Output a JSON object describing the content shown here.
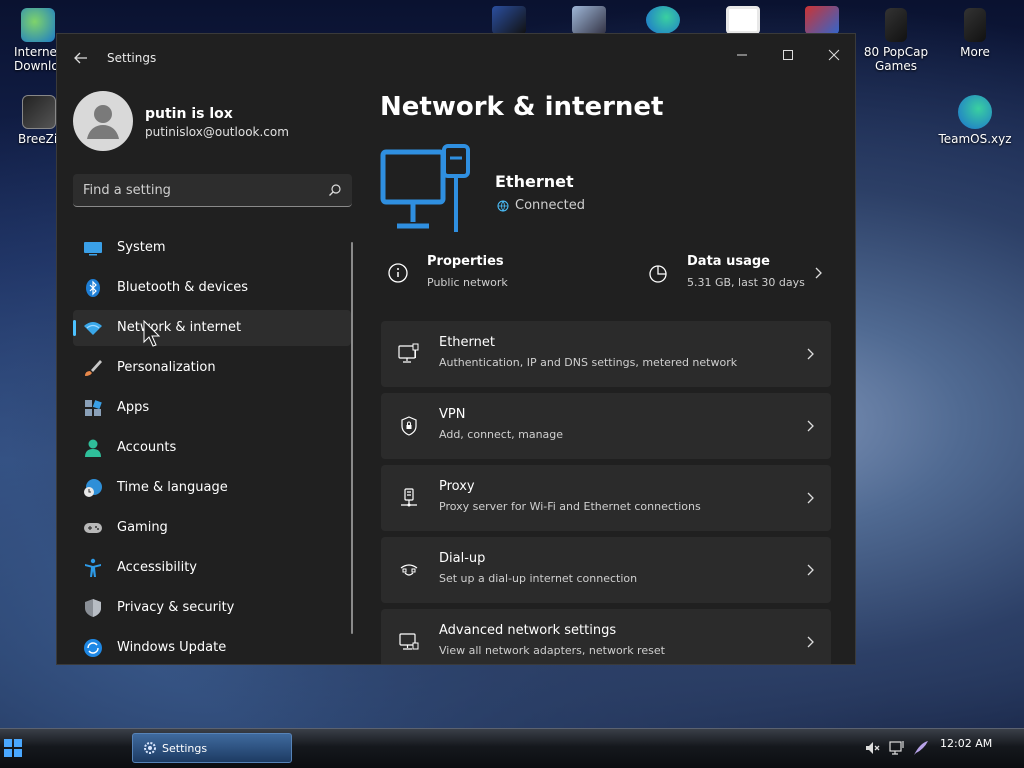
{
  "desktop": {
    "icons": [
      {
        "label": "Interne\nDownlo"
      },
      {
        "label": "BreeZip"
      },
      {
        "label": "80 PopCap Games"
      },
      {
        "label": "More"
      },
      {
        "label": "TeamOS.xyz"
      }
    ]
  },
  "window": {
    "title": "Settings"
  },
  "profile": {
    "name": "putin is lox",
    "email": "putinislox@outlook.com"
  },
  "search": {
    "placeholder": "Find a setting"
  },
  "sidebar": {
    "items": [
      {
        "label": "System",
        "icon": "monitor-icon",
        "active": false
      },
      {
        "label": "Bluetooth & devices",
        "icon": "bluetooth-icon",
        "active": false
      },
      {
        "label": "Network & internet",
        "icon": "wifi-icon",
        "active": true
      },
      {
        "label": "Personalization",
        "icon": "brush-icon",
        "active": false
      },
      {
        "label": "Apps",
        "icon": "apps-icon",
        "active": false
      },
      {
        "label": "Accounts",
        "icon": "person-icon",
        "active": false
      },
      {
        "label": "Time & language",
        "icon": "globe-clock-icon",
        "active": false
      },
      {
        "label": "Gaming",
        "icon": "gamepad-icon",
        "active": false
      },
      {
        "label": "Accessibility",
        "icon": "accessibility-icon",
        "active": false
      },
      {
        "label": "Privacy & security",
        "icon": "shield-icon",
        "active": false
      },
      {
        "label": "Windows Update",
        "icon": "update-icon",
        "active": false
      }
    ]
  },
  "main": {
    "title": "Network & internet",
    "connection": {
      "name": "Ethernet",
      "status": "Connected"
    },
    "properties": {
      "title": "Properties",
      "subtitle": "Public network"
    },
    "data_usage": {
      "title": "Data usage",
      "subtitle": "5.31 GB, last 30 days"
    },
    "rows": [
      {
        "title": "Ethernet",
        "subtitle": "Authentication, IP and DNS settings, metered network",
        "icon": "ethernet-icon"
      },
      {
        "title": "VPN",
        "subtitle": "Add, connect, manage",
        "icon": "vpn-shield-icon"
      },
      {
        "title": "Proxy",
        "subtitle": "Proxy server for Wi-Fi and Ethernet connections",
        "icon": "proxy-icon"
      },
      {
        "title": "Dial-up",
        "subtitle": "Set up a dial-up internet connection",
        "icon": "dialup-icon"
      },
      {
        "title": "Advanced network settings",
        "subtitle": "View all network adapters, network reset",
        "icon": "advanced-network-icon"
      }
    ]
  },
  "taskbar": {
    "app_label": "Settings",
    "clock": "12:02 AM"
  },
  "colors": {
    "accent": "#4cc2ff",
    "window_bg": "#202020",
    "card_bg": "#2b2b2b"
  }
}
